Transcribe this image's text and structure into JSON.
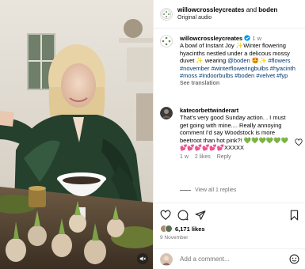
{
  "header": {
    "author": "willowcrossleycreates",
    "joiner": " and ",
    "collaborator": "boden",
    "audio": "Original audio"
  },
  "caption": {
    "author": "willowcrossleycreates",
    "time": "1 w",
    "text": "A bowl of Instant Joy ✨Winter flowering hyacinths nestled under a delicous mossy duvet ✨ wearing ",
    "mention": "@boden",
    "emoji_after_mention": " 🤩✨",
    "hashtags": "#flowers #november #winterfloweringbulbs #hyacinth #moss #indoorbulbs #boden #velvet #fyp",
    "see_translation": "See translation"
  },
  "comment": {
    "author": "katecorbettwinderart",
    "time": "1 w",
    "text": "That's very good Sunday action. . I must get going with mine.... Really annoying comment I'd say Woodstock is more beetroot than hot pink?! 💚💚💚💚💚💚💕💕💕💕💕💕XXXXX",
    "likes": "2 likes",
    "reply": "Reply",
    "view_replies": "View all 1 replies"
  },
  "post": {
    "likes": "6,171 likes",
    "date": "9 November"
  },
  "compose": {
    "placeholder": "Add a comment..."
  },
  "colors": {
    "verified": "#0095f6",
    "link": "#00376b",
    "muted": "#737373",
    "border": "#efefef"
  },
  "icons": [
    "mute-icon",
    "heart-icon",
    "comment-icon",
    "share-icon",
    "bookmark-icon",
    "verified-icon",
    "emoji-icon"
  ]
}
